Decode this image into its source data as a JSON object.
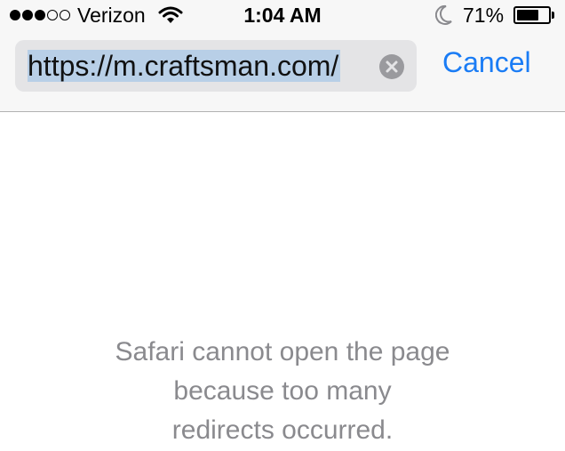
{
  "status_bar": {
    "carrier": "Verizon",
    "time": "1:04 AM",
    "battery_percent": "71%",
    "battery_level": 0.71,
    "signal_bars_filled": 3,
    "signal_bars_total": 5,
    "icons": [
      "signal-dots-icon",
      "wifi-icon",
      "moon-icon",
      "battery-icon"
    ]
  },
  "address_bar": {
    "url": "https://m.craftsman.com/",
    "clear_icon": "clear-icon",
    "cancel_label": "Cancel"
  },
  "error": {
    "lines": [
      "Safari cannot open the page",
      "because too many",
      "redirects occurred."
    ]
  },
  "colors": {
    "accent": "#1a7cf5",
    "selection": "#b8cfe7",
    "message_gray": "#8a8a8e"
  }
}
